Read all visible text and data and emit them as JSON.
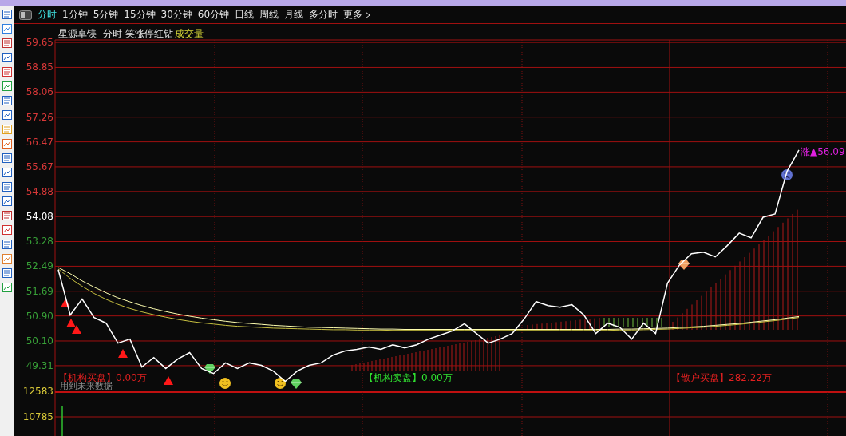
{
  "period_tabs": [
    {
      "label": "分时",
      "selected": true
    },
    {
      "label": "1分钟",
      "selected": false
    },
    {
      "label": "5分钟",
      "selected": false
    },
    {
      "label": "15分钟",
      "selected": false
    },
    {
      "label": "30分钟",
      "selected": false
    },
    {
      "label": "60分钟",
      "selected": false
    },
    {
      "label": "日线",
      "selected": false
    },
    {
      "label": "周线",
      "selected": false
    },
    {
      "label": "月线",
      "selected": false
    },
    {
      "label": "多分时",
      "selected": false
    },
    {
      "label": "更多",
      "selected": false
    }
  ],
  "chart_header": {
    "stock": "星源卓镁",
    "mode": "分时",
    "indicator": "笑涨停红钻",
    "volume": "成交量"
  },
  "price_chart": {
    "chart_data": {
      "type": "line",
      "ylim": [
        48.49,
        59.73
      ],
      "grid": true,
      "yticks": [
        {
          "value": 59.65,
          "label": "59.65"
        },
        {
          "value": 58.85,
          "label": "58.85"
        },
        {
          "value": 58.06,
          "label": "58.06"
        },
        {
          "value": 57.26,
          "label": "57.26"
        },
        {
          "value": 56.47,
          "label": "56.47"
        },
        {
          "value": 55.67,
          "label": "55.67"
        },
        {
          "value": 54.88,
          "label": "54.88"
        },
        {
          "value": 54.08,
          "label": "54.08"
        },
        {
          "value": 53.28,
          "label": "53.28"
        },
        {
          "value": 52.49,
          "label": "52.49"
        },
        {
          "value": 51.69,
          "label": "51.69"
        },
        {
          "value": 50.9,
          "label": "50.90"
        },
        {
          "value": 50.1,
          "label": "50.10"
        },
        {
          "value": 49.31,
          "label": "49.31"
        }
      ],
      "series": [
        {
          "color": "#ffffff",
          "values": [
            52.38,
            50.93,
            51.44,
            50.85,
            50.67,
            50.03,
            50.16,
            49.27,
            49.57,
            49.22,
            49.52,
            49.73,
            49.22,
            49.06,
            49.4,
            49.22,
            49.4,
            49.32,
            49.14,
            48.81,
            49.14,
            49.32,
            49.4,
            49.65,
            49.78,
            49.83,
            49.91,
            49.83,
            49.98,
            49.88,
            49.98,
            50.16,
            50.29,
            50.42,
            50.65,
            50.34,
            50.03,
            50.16,
            50.34,
            50.8,
            51.36,
            51.23,
            51.18,
            51.26,
            50.93,
            50.34,
            50.67,
            50.54,
            50.16,
            50.67,
            50.34,
            51.95,
            52.53,
            52.89,
            52.94,
            52.79,
            53.15,
            53.55,
            53.4,
            54.06,
            54.16,
            55.52,
            56.21
          ]
        },
        {
          "color": "#c8c040",
          "values": [
            52.4,
            52.1,
            51.85,
            51.62,
            51.43,
            51.27,
            51.14,
            51.03,
            50.94,
            50.86,
            50.79,
            50.73,
            50.68,
            50.64,
            50.6,
            50.57,
            50.55,
            50.53,
            50.51,
            50.5,
            50.49,
            50.48,
            50.47,
            50.46,
            50.46,
            50.45,
            50.45,
            50.45,
            50.44,
            50.44,
            50.44,
            50.44,
            50.44,
            50.44,
            50.44,
            50.44,
            50.44,
            50.44,
            50.44,
            50.44,
            50.44,
            50.44,
            50.44,
            50.44,
            50.44,
            50.44,
            50.44,
            50.45,
            50.45,
            50.46,
            50.47,
            50.48,
            50.5,
            50.52,
            50.54,
            50.57,
            50.6,
            50.63,
            50.67,
            50.71,
            50.75,
            50.8,
            50.85
          ]
        },
        {
          "color": "#ffffb0",
          "values": [
            52.45,
            52.25,
            52.02,
            51.82,
            51.64,
            51.48,
            51.35,
            51.23,
            51.13,
            51.04,
            50.96,
            50.89,
            50.83,
            50.78,
            50.73,
            50.69,
            50.66,
            50.63,
            50.6,
            50.58,
            50.56,
            50.54,
            50.53,
            50.52,
            50.51,
            50.5,
            50.49,
            50.48,
            50.48,
            50.47,
            50.47,
            50.47,
            50.47,
            50.47,
            50.47,
            50.47,
            50.47,
            50.47,
            50.47,
            50.47,
            50.47,
            50.47,
            50.47,
            50.47,
            50.47,
            50.47,
            50.47,
            50.48,
            50.48,
            50.49,
            50.5,
            50.51,
            50.53,
            50.55,
            50.57,
            50.6,
            50.63,
            50.66,
            50.7,
            50.74,
            50.78,
            50.83,
            50.88
          ]
        }
      ]
    },
    "last_price": "涨▲56.09",
    "flow_labels": [
      {
        "text": "【机构买盘】0.00万",
        "color": "#e02020"
      },
      {
        "text": "【机构卖盘】0.00万",
        "color": "#30e030"
      },
      {
        "text": "【散户买盘】282.22万",
        "color": "#e02020"
      }
    ],
    "warning": "用到未来数据"
  },
  "volume_axis": [
    "12583",
    "10785"
  ]
}
